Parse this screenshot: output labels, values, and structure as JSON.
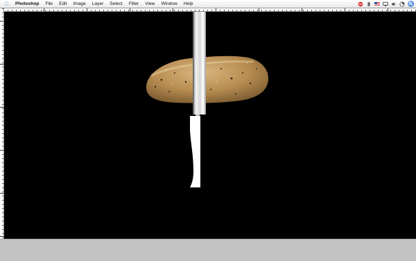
{
  "menubar": {
    "apple_icon": "apple-icon",
    "app_name": "Photoshop",
    "items": [
      "File",
      "Edit",
      "Image",
      "Layer",
      "Select",
      "Filter",
      "View",
      "Window",
      "Help"
    ],
    "status_icons": [
      "no-entry-icon",
      "bluetooth-icon",
      "us-flag-icon",
      "display-icon",
      "volume-icon",
      "battery-icon",
      "spotlight-icon"
    ]
  },
  "canvas": {
    "background": "#000000",
    "objects": [
      "bread-roll",
      "bread-knife"
    ]
  }
}
